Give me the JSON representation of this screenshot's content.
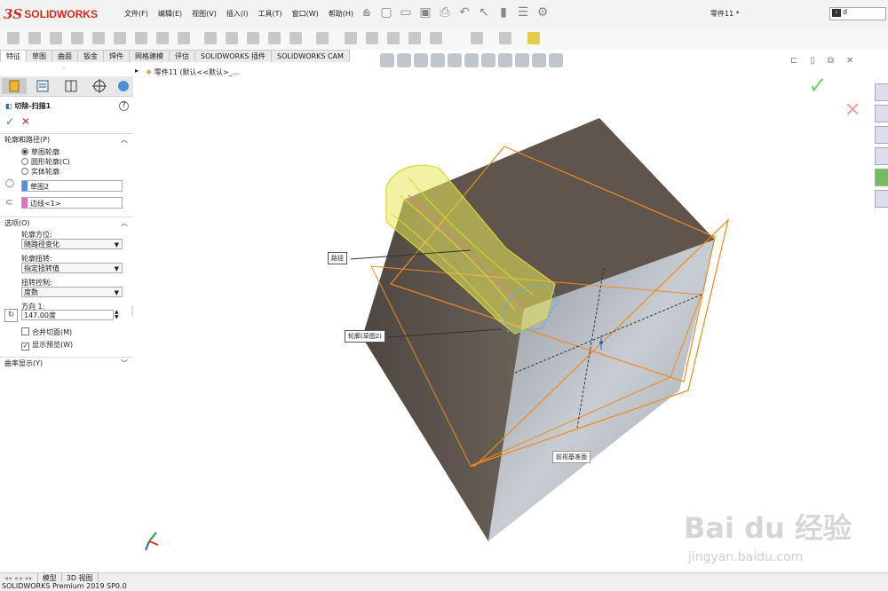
{
  "app": {
    "logo_prefix": "3S",
    "logo_text": "SOLIDWORKS"
  },
  "menu": [
    "文件(F)",
    "编辑(E)",
    "视图(V)",
    "插入(I)",
    "工具(T)",
    "窗口(W)",
    "帮助(H)"
  ],
  "document_title": "零件11 *",
  "search": {
    "value": "d"
  },
  "command_tabs": [
    "特征",
    "草图",
    "曲面",
    "钣金",
    "焊件",
    "网格建模",
    "评估",
    "SOLIDWORKS 插件",
    "SOLIDWORKS CAM"
  ],
  "active_tab_index": 0,
  "breadcrumb": "零件11  (默认<<默认>_...",
  "property_manager": {
    "title": "切除-扫描1",
    "help": "?",
    "sections": {
      "profile_path": "轮廓和路径(P)",
      "options": "选项(O)",
      "curvature": "曲率显示(Y)"
    },
    "profile_types": [
      "草图轮廓",
      "圆形轮廓(C)",
      "实体轮廓"
    ],
    "profile_selected_index": 0,
    "profile_field": "草图2",
    "path_field": "边线<1>",
    "orientation_label": "轮廓方位:",
    "orientation_value": "随路径变化",
    "twist_label": "轮廓扭转:",
    "twist_value": "指定扭转值",
    "twist_control_label": "扭转控制:",
    "twist_control_value": "度数",
    "direction_label": "方向 1:",
    "direction_value": "147.00度",
    "merge_faces": "合并切面(M)",
    "merge_checked": false,
    "show_preview": "显示预览(W)",
    "preview_checked": true
  },
  "callouts": {
    "path": "路径",
    "profile": "轮廓(草图2)",
    "front_plane": "前视基准面"
  },
  "bottom_tabs": [
    "模型",
    "3D 视图"
  ],
  "status_text": "SOLIDWORKS Premium 2019 SP0.0",
  "watermark": {
    "main": "Bai du 经验",
    "sub": "jingyan.baidu.com"
  },
  "colors": {
    "accent": "#d52b1e",
    "preview": "#e8e85a",
    "plane": "#f08a1c",
    "ok": "#2ea043",
    "cancel": "#d9342b"
  }
}
